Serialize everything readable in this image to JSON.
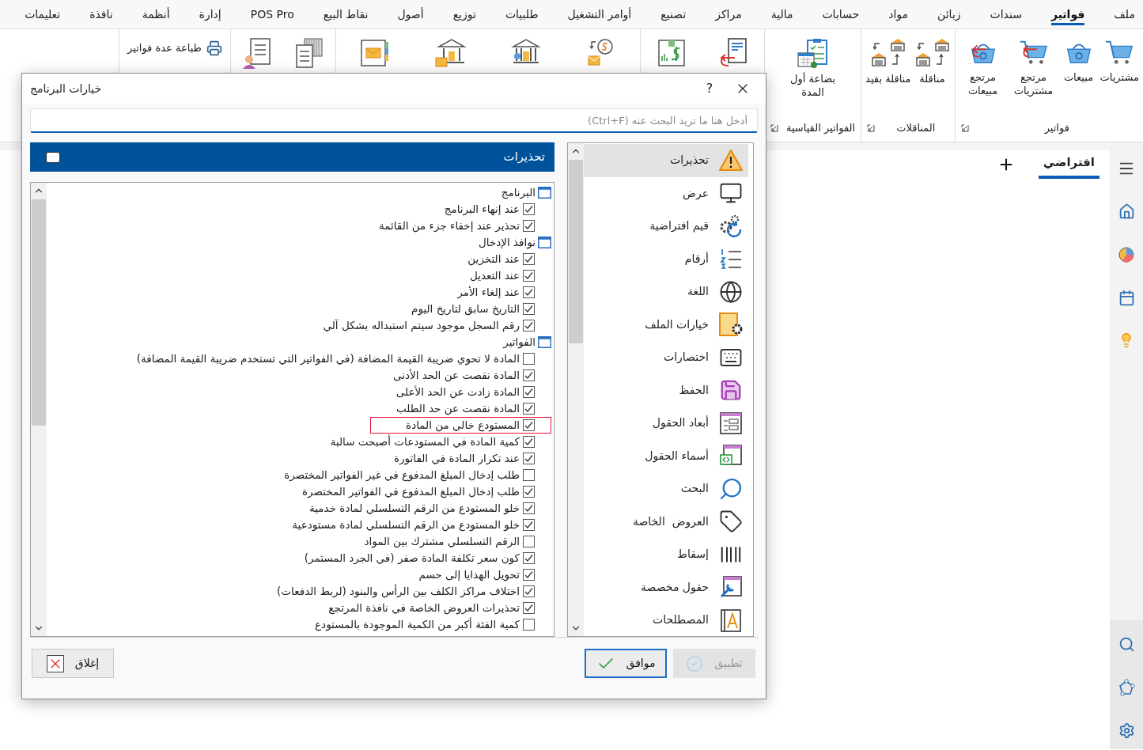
{
  "menu": [
    {
      "label": "ملف",
      "selected": false
    },
    {
      "label": "فواتير",
      "selected": true
    },
    {
      "label": "سندات",
      "selected": false
    },
    {
      "label": "زبائن",
      "selected": false
    },
    {
      "label": "مواد",
      "selected": false
    },
    {
      "label": "حسابات",
      "selected": false
    },
    {
      "label": "مالية",
      "selected": false
    },
    {
      "label": "مراكز",
      "selected": false
    },
    {
      "label": "تصنيع",
      "selected": false
    },
    {
      "label": "أوامر التشغيل",
      "selected": false
    },
    {
      "label": "طلبيات",
      "selected": false
    },
    {
      "label": "توزيع",
      "selected": false
    },
    {
      "label": "أصول",
      "selected": false
    },
    {
      "label": "نقاط البيع",
      "selected": false
    },
    {
      "label": "POS Pro",
      "selected": false
    },
    {
      "label": "إدارة",
      "selected": false
    },
    {
      "label": "أنظمة",
      "selected": false
    },
    {
      "label": "نافذة",
      "selected": false
    },
    {
      "label": "تعليمات",
      "selected": false
    }
  ],
  "ribbon": {
    "groups": [
      {
        "label": "فواتير",
        "items": [
          "مشتريات",
          "مبيعات",
          "مرتجع مشتريات",
          "مرتجع مبيعات"
        ]
      },
      {
        "label": "المناقلات",
        "items": [
          "مناقلة",
          "مناقلة بقيد"
        ]
      },
      {
        "label": "الفواتير القياسية",
        "items": [
          "بضاعة أول المدة"
        ]
      }
    ],
    "print_item": "طباعة عدة فواتير"
  },
  "tabs": [
    {
      "label": "افتراضي",
      "selected": true
    }
  ],
  "dialog": {
    "title": "خيارات البرنامج",
    "help": "?",
    "search": {
      "placeholder": "أدخل هنا ما تريد البحث عنه (Ctrl+F)"
    },
    "nav": [
      {
        "label": "تحذيرات",
        "selected": true
      },
      {
        "label": "عرض",
        "selected": false
      },
      {
        "label": "قيم افتراضية",
        "selected": false
      },
      {
        "label": "أرقام",
        "selected": false
      },
      {
        "label": "اللغة",
        "selected": false
      },
      {
        "label": "خيارات الملف",
        "selected": false
      },
      {
        "label": "اختصارات",
        "selected": false
      },
      {
        "label": "الحفظ",
        "selected": false
      },
      {
        "label": "أبعاد الحقول",
        "selected": false
      },
      {
        "label": "أسماء الحقول",
        "selected": false
      },
      {
        "label": "البحث",
        "selected": false
      },
      {
        "label": "العروض  الخاصة",
        "selected": false
      },
      {
        "label": "إسقاط",
        "selected": false
      },
      {
        "label": "حقول مخصصة",
        "selected": false
      },
      {
        "label": "المصطلحات",
        "selected": false
      }
    ],
    "panel_title": "تحذيرات",
    "tree": [
      {
        "label": "البرنامج",
        "children": [
          {
            "label": "عند إنهاء البرنامج",
            "checked": true,
            "selected": false
          },
          {
            "label": "تحذير عند إخفاء جزء من القائمة",
            "checked": true,
            "selected": false
          }
        ]
      },
      {
        "label": "نوافذ الإدخال",
        "children": [
          {
            "label": "عند التخزين",
            "checked": true,
            "selected": false
          },
          {
            "label": "عند التعديل",
            "checked": true,
            "selected": false
          },
          {
            "label": "عند إلغاء الأمر",
            "checked": true,
            "selected": false
          },
          {
            "label": "التاريخ سابق لتاريخ اليوم",
            "checked": true,
            "selected": false
          },
          {
            "label": "رقم السجل موجود سيتم استبداله بشكل آلي",
            "checked": true,
            "selected": false
          }
        ]
      },
      {
        "label": "الفواتير",
        "children": [
          {
            "label": "المادة لا تحوي ضريبة القيمة المضافة (في الفواتير التي تستخدم ضريبة القيمة المضافة)",
            "checked": false,
            "selected": false
          },
          {
            "label": "المادة نقصت عن الحد الأدنى",
            "checked": true,
            "selected": false
          },
          {
            "label": "المادة زادت عن الحد الأعلى",
            "checked": true,
            "selected": false
          },
          {
            "label": "المادة نقصت عن حد الطلب",
            "checked": true,
            "selected": false
          },
          {
            "label": "المستودع خالي من المادة",
            "checked": true,
            "selected": true
          },
          {
            "label": "كمية المادة في المستودعات أصبحت سالبة",
            "checked": true,
            "selected": false
          },
          {
            "label": "عند تكرار المادة في الفاتورة",
            "checked": true,
            "selected": false
          },
          {
            "label": "طلب إدخال المبلغ المدفوع في غير الفواتير المختصرة",
            "checked": false,
            "selected": false
          },
          {
            "label": "طلب إدخال المبلغ المدفوع في الفواتير المختصرة",
            "checked": true,
            "selected": false
          },
          {
            "label": "خلو المستودع من الرقم التسلسلي لمادة خدمية",
            "checked": true,
            "selected": false
          },
          {
            "label": "خلو المستودع من الرقم التسلسلي لمادة مستودعية",
            "checked": true,
            "selected": false
          },
          {
            "label": "الرقم التسلسلي مشترك بين المواد",
            "checked": false,
            "selected": false
          },
          {
            "label": "كون سعر تكلفة المادة صفر (في الجرد المستمر)",
            "checked": true,
            "selected": false
          },
          {
            "label": "تحويل الهدايا إلى حسم",
            "checked": true,
            "selected": false
          },
          {
            "label": "اختلاف مراكز الكلف بين الرأس والبنود (لربط الدفعات)",
            "checked": true,
            "selected": false
          },
          {
            "label": "تحذيرات العروض الخاصة في نافذة المرتجع",
            "checked": true,
            "selected": false
          },
          {
            "label": "كمية الفئة أكبر من الكمية الموجودة بالمستودع",
            "checked": false,
            "selected": false
          }
        ]
      }
    ],
    "buttons": [
      {
        "label": "تطبيق",
        "kind": "apply",
        "disabled": true,
        "default": false
      },
      {
        "label": "موافق",
        "kind": "ok",
        "disabled": false,
        "default": true
      },
      {
        "label": "إغلاق",
        "kind": "close",
        "disabled": false,
        "default": false
      }
    ]
  }
}
